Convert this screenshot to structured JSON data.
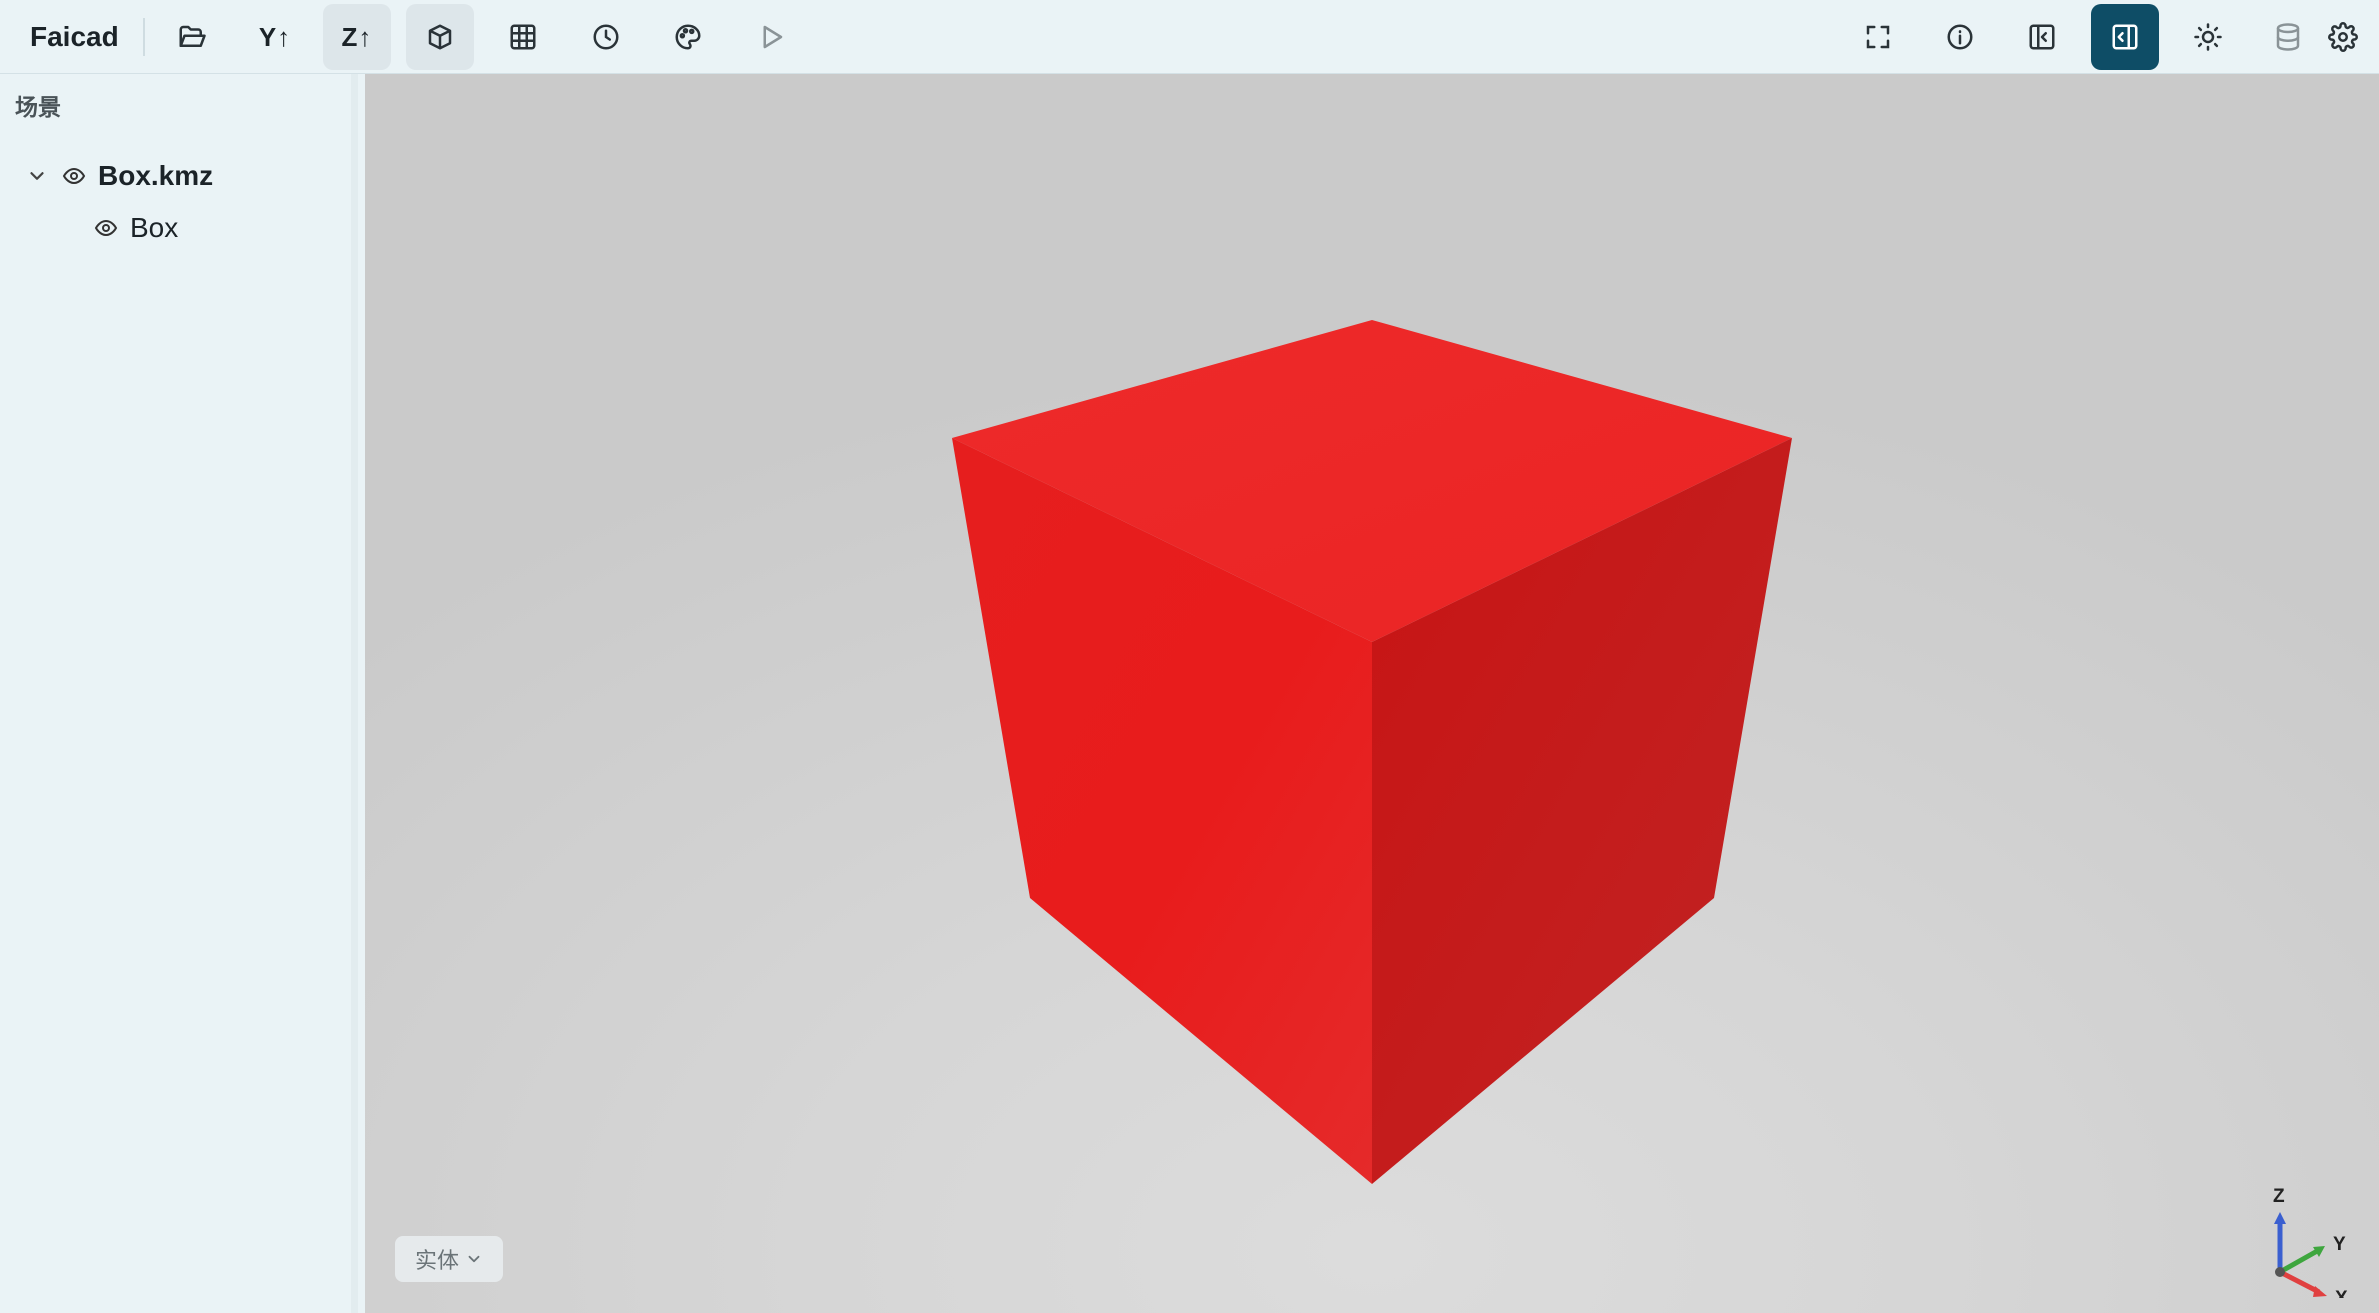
{
  "app": {
    "title": "Faicad"
  },
  "toolbar": {
    "left_buttons": [
      {
        "name": "open-folder",
        "icon": "folder-open-icon"
      },
      {
        "name": "y-up",
        "label": "Y↑"
      },
      {
        "name": "z-up",
        "label": "Z↑",
        "state": "pressed"
      },
      {
        "name": "solid-view",
        "icon": "box-3d-icon",
        "state": "pressed"
      },
      {
        "name": "grid",
        "icon": "grid-icon"
      },
      {
        "name": "history",
        "icon": "clock-icon"
      },
      {
        "name": "material",
        "icon": "palette-icon"
      },
      {
        "name": "play",
        "icon": "play-icon"
      }
    ],
    "right_buttons": [
      {
        "name": "fullscreen",
        "icon": "fullscreen-icon"
      },
      {
        "name": "info",
        "icon": "info-icon"
      },
      {
        "name": "left-panel",
        "icon": "panel-left-icon"
      },
      {
        "name": "right-panel",
        "icon": "panel-right-icon",
        "state": "active"
      },
      {
        "name": "lighting",
        "icon": "sun-icon"
      },
      {
        "name": "database",
        "icon": "database-icon"
      },
      {
        "name": "settings",
        "icon": "gear-icon"
      }
    ]
  },
  "sidebar": {
    "title": "场景",
    "tree": [
      {
        "label": "Box.kmz",
        "expanded": true,
        "visible": true,
        "children": [
          {
            "label": "Box",
            "visible": true
          }
        ]
      }
    ]
  },
  "viewport": {
    "background": "#d6d6d6",
    "model_color": "#e52222",
    "display_mode": "实体",
    "axes": {
      "z": "Z",
      "y": "Y",
      "x": "X"
    },
    "axis_colors": {
      "x": "#e04040",
      "y": "#3ea63e",
      "z": "#3a5fd0"
    }
  },
  "colors": {
    "accent": "#0e4d66",
    "panel": "#eaf3f6"
  }
}
